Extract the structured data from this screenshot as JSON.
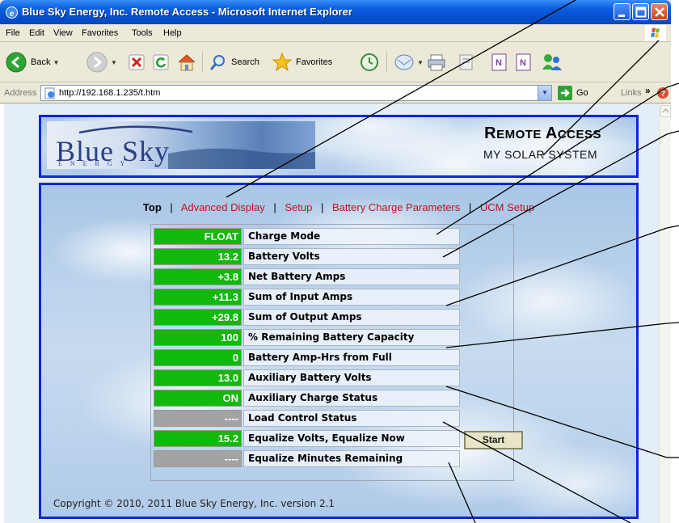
{
  "window": {
    "title": "Blue Sky Energy, Inc. Remote Access - Microsoft Internet Explorer"
  },
  "menu": [
    "File",
    "Edit",
    "View",
    "Favorites",
    "Tools",
    "Help"
  ],
  "toolbar": {
    "back_label": "Back",
    "search_label": "Search",
    "favorites_label": "Favorites"
  },
  "address": {
    "label": "Address",
    "url": "http://192.168.1.235/t.htm",
    "go_label": "Go",
    "links_label": "Links"
  },
  "header": {
    "logo_text": "Blue Sky",
    "logo_sub": "ENERGY",
    "title_r": "R",
    "title_emote": "EMOTE",
    "title_a": "A",
    "title_ccess": "CCESS",
    "subtitle": "MY SOLAR SYSTEM"
  },
  "nav": {
    "current": "Top",
    "separator": "|",
    "links": [
      "Advanced Display",
      "Setup",
      "Battery Charge Parameters",
      "UCM Setup"
    ]
  },
  "rows": [
    {
      "value": "FLOAT",
      "label": "Charge Mode",
      "status": "green"
    },
    {
      "value": "13.2",
      "label": "Battery Volts",
      "status": "green"
    },
    {
      "value": "+3.8",
      "label": "Net Battery Amps",
      "status": "green"
    },
    {
      "value": "+11.3",
      "label": "Sum of Input Amps",
      "status": "green"
    },
    {
      "value": "+29.8",
      "label": "Sum of Output Amps",
      "status": "green"
    },
    {
      "value": "100",
      "label": "% Remaining Battery Capacity",
      "status": "green"
    },
    {
      "value": "0",
      "label": "Battery Amp-Hrs from Full",
      "status": "green"
    },
    {
      "value": "13.0",
      "label": "Auxiliary Battery Volts",
      "status": "green"
    },
    {
      "value": "ON",
      "label": "Auxiliary Charge Status",
      "status": "green"
    },
    {
      "value": "----",
      "label": "Load Control Status",
      "status": "gray"
    },
    {
      "value": "15.2",
      "label": "Equalize Volts, Equalize Now",
      "status": "green"
    },
    {
      "value": "----",
      "label": "Equalize Minutes Remaining",
      "status": "gray"
    }
  ],
  "equalize_button": "Start",
  "copyright": "Copyright © 2010, 2011 Blue Sky Energy, Inc. version 2.1",
  "colors": {
    "value_on": "#12b80c",
    "value_off": "#a3a3a3",
    "frame_border": "#1126d6",
    "nav_link": "#c0131b"
  }
}
